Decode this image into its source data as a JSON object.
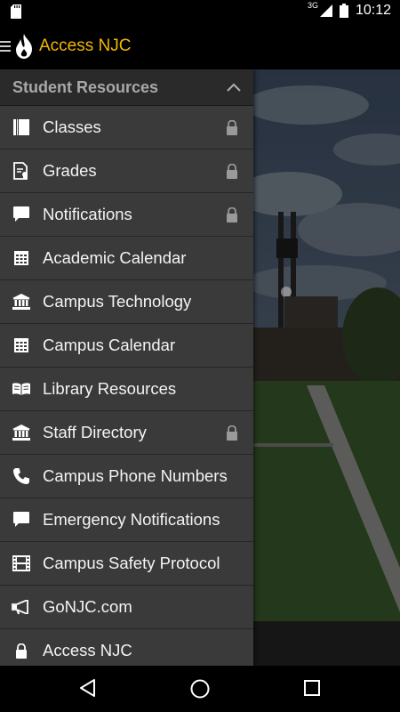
{
  "status_bar": {
    "network": "3G",
    "time": "10:12"
  },
  "app_bar": {
    "title": "Access NJC"
  },
  "drawer": {
    "section_title": "Student Resources",
    "items": [
      {
        "label": "Classes",
        "icon": "book-icon",
        "locked": true
      },
      {
        "label": "Grades",
        "icon": "grades-icon",
        "locked": true
      },
      {
        "label": "Notifications",
        "icon": "chat-bubble-icon",
        "locked": true
      },
      {
        "label": "Academic Calendar",
        "icon": "calendar-icon",
        "locked": false
      },
      {
        "label": "Campus Technology",
        "icon": "institution-icon",
        "locked": false
      },
      {
        "label": "Campus Calendar",
        "icon": "calendar-icon",
        "locked": false
      },
      {
        "label": "Library Resources",
        "icon": "open-book-icon",
        "locked": false
      },
      {
        "label": "Staff Directory",
        "icon": "institution-icon",
        "locked": true
      },
      {
        "label": "Campus Phone Numbers",
        "icon": "phone-icon",
        "locked": false
      },
      {
        "label": "Emergency Notifications",
        "icon": "chat-bubble-icon",
        "locked": false
      },
      {
        "label": "Campus Safety Protocol",
        "icon": "film-icon",
        "locked": false
      },
      {
        "label": "GoNJC.com",
        "icon": "megaphone-icon",
        "locked": false
      },
      {
        "label": "Access NJC",
        "icon": "lock-icon",
        "locked": false
      }
    ]
  },
  "colors": {
    "accent": "#f2b600",
    "drawer_bg": "#3a3a3a",
    "header_bg": "#2a2a2a"
  }
}
